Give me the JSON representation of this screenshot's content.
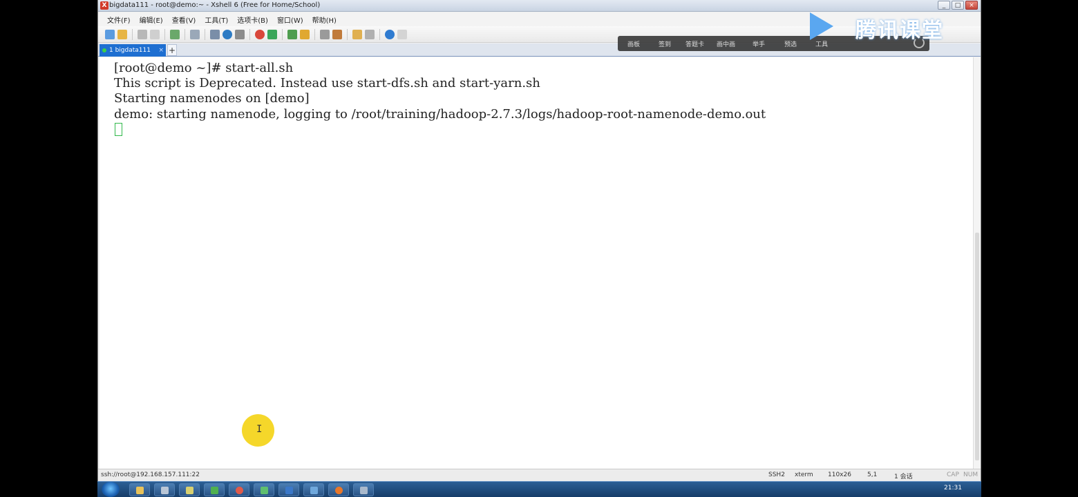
{
  "window": {
    "title": "bigdata111 - root@demo:~ - Xshell 6 (Free for Home/School)",
    "app_icon_glyph": "X"
  },
  "menu": [
    "文件(F)",
    "编辑(E)",
    "查看(V)",
    "工具(T)",
    "选项卡(B)",
    "窗口(W)",
    "帮助(H)"
  ],
  "tab": {
    "label": "1 bigdata111",
    "close_glyph": "×",
    "add_glyph": "+"
  },
  "terminal": {
    "lines": [
      "[root@demo ~]# start-all.sh",
      "This script is Deprecated. Instead use start-dfs.sh and start-yarn.sh",
      "Starting namenodes on [demo]",
      "demo: starting namenode, logging to /root/training/hadoop-2.7.3/logs/hadoop-root-namenode-demo.out"
    ]
  },
  "statusbar": {
    "connection": "ssh://root@192.168.157.111:22",
    "protocol": "SSH2",
    "terminal_type": "xterm",
    "size": "110x26",
    "cursor_pos": "5,1",
    "sessions": "1 会话",
    "caps": "CAP",
    "num": "NUM"
  },
  "overlay": {
    "items": [
      "画板",
      "签到",
      "答题卡",
      "画中画",
      "举手",
      "预选",
      "工具"
    ]
  },
  "brand": {
    "text": "腾讯课堂"
  },
  "taskbar": {
    "clock": "21:31"
  },
  "pointer": {
    "glyph": "I"
  }
}
